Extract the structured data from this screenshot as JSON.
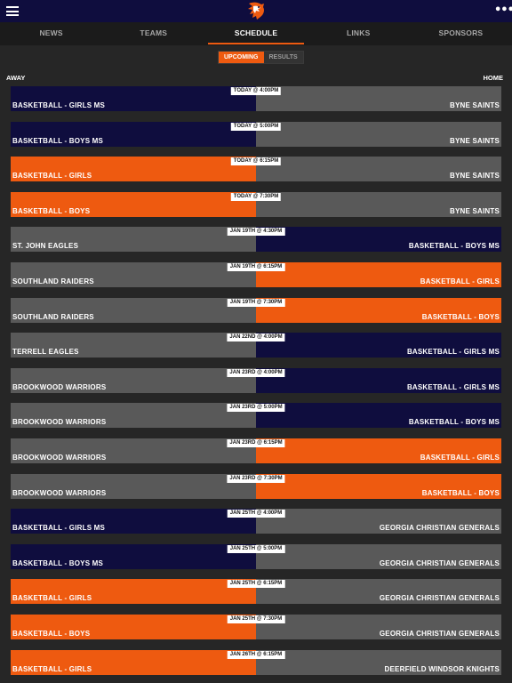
{
  "app": {
    "colors": {
      "navy": "#0f0d3e",
      "orange": "#ee5a10",
      "gray": "#595959",
      "background": "#262626"
    },
    "icons": {
      "menu": "hamburger-icon",
      "logo": "mustang-logo-icon",
      "more": "more-dots-icon"
    }
  },
  "nav": {
    "tabs": [
      {
        "label": "NEWS",
        "active": false
      },
      {
        "label": "TEAMS",
        "active": false
      },
      {
        "label": "SCHEDULE",
        "active": true
      },
      {
        "label": "LINKS",
        "active": false
      },
      {
        "label": "SPONSORS",
        "active": false
      }
    ]
  },
  "schedule": {
    "segments": [
      {
        "label": "UPCOMING",
        "active": true
      },
      {
        "label": "RESULTS",
        "active": false
      }
    ],
    "away_label": "AWAY",
    "home_label": "HOME",
    "games": [
      {
        "time": "TODAY @ 4:00PM",
        "away": "BASKETBALL - GIRLS MS",
        "home": "BYNE SAINTS",
        "away_color": "#0f0d3e",
        "home_color": "#595959"
      },
      {
        "time": "TODAY @ 5:00PM",
        "away": "BASKETBALL - BOYS MS",
        "home": "BYNE SAINTS",
        "away_color": "#0f0d3e",
        "home_color": "#595959"
      },
      {
        "time": "TODAY @ 6:15PM",
        "away": "BASKETBALL - GIRLS",
        "home": "BYNE SAINTS",
        "away_color": "#ee5a10",
        "home_color": "#595959"
      },
      {
        "time": "TODAY @ 7:30PM",
        "away": "BASKETBALL - BOYS",
        "home": "BYNE SAINTS",
        "away_color": "#ee5a10",
        "home_color": "#595959"
      },
      {
        "time": "JAN 19TH @ 4:30PM",
        "away": "ST. JOHN EAGLES",
        "home": "BASKETBALL - BOYS MS",
        "away_color": "#595959",
        "home_color": "#0f0d3e"
      },
      {
        "time": "JAN 19TH @ 6:15PM",
        "away": "SOUTHLAND RAIDERS",
        "home": "BASKETBALL - GIRLS",
        "away_color": "#595959",
        "home_color": "#ee5a10"
      },
      {
        "time": "JAN 19TH @ 7:30PM",
        "away": "SOUTHLAND RAIDERS",
        "home": "BASKETBALL - BOYS",
        "away_color": "#595959",
        "home_color": "#ee5a10"
      },
      {
        "time": "JAN 22ND @ 4:00PM",
        "away": "TERRELL EAGLES",
        "home": "BASKETBALL - GIRLS MS",
        "away_color": "#595959",
        "home_color": "#0f0d3e"
      },
      {
        "time": "JAN 23RD @ 4:00PM",
        "away": "BROOKWOOD WARRIORS",
        "home": "BASKETBALL - GIRLS MS",
        "away_color": "#595959",
        "home_color": "#0f0d3e"
      },
      {
        "time": "JAN 23RD @ 5:00PM",
        "away": "BROOKWOOD WARRIORS",
        "home": "BASKETBALL - BOYS MS",
        "away_color": "#595959",
        "home_color": "#0f0d3e"
      },
      {
        "time": "JAN 23RD @ 6:15PM",
        "away": "BROOKWOOD WARRIORS",
        "home": "BASKETBALL - GIRLS",
        "away_color": "#595959",
        "home_color": "#ee5a10"
      },
      {
        "time": "JAN 23RD @ 7:30PM",
        "away": "BROOKWOOD WARRIORS",
        "home": "BASKETBALL - BOYS",
        "away_color": "#595959",
        "home_color": "#ee5a10"
      },
      {
        "time": "JAN 25TH @ 4:00PM",
        "away": "BASKETBALL - GIRLS MS",
        "home": "GEORGIA CHRISTIAN GENERALS",
        "away_color": "#0f0d3e",
        "home_color": "#595959"
      },
      {
        "time": "JAN 25TH @ 5:00PM",
        "away": "BASKETBALL - BOYS MS",
        "home": "GEORGIA CHRISTIAN GENERALS",
        "away_color": "#0f0d3e",
        "home_color": "#595959"
      },
      {
        "time": "JAN 25TH @ 6:15PM",
        "away": "BASKETBALL - GIRLS",
        "home": "GEORGIA CHRISTIAN GENERALS",
        "away_color": "#ee5a10",
        "home_color": "#595959"
      },
      {
        "time": "JAN 25TH @ 7:30PM",
        "away": "BASKETBALL - BOYS",
        "home": "GEORGIA CHRISTIAN GENERALS",
        "away_color": "#ee5a10",
        "home_color": "#595959"
      },
      {
        "time": "JAN 26TH @ 6:15PM",
        "away": "BASKETBALL - GIRLS",
        "home": "DEERFIELD WINDSOR KNIGHTS",
        "away_color": "#ee5a10",
        "home_color": "#595959"
      }
    ]
  }
}
